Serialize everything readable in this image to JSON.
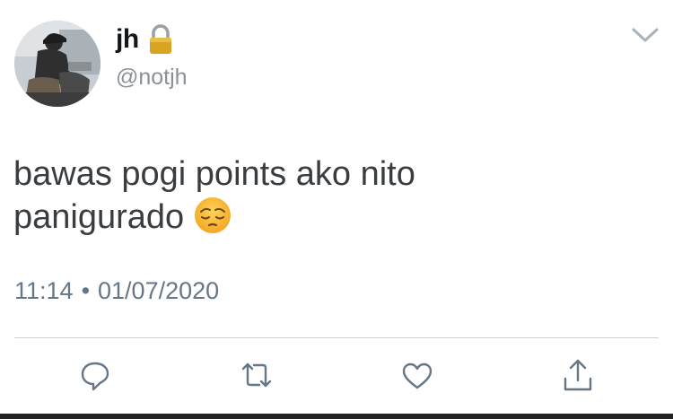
{
  "user": {
    "display_name": "jh",
    "handle": "@notjh",
    "protected_icon": "lock-icon",
    "avatar": "profile-photo"
  },
  "menu_icon": "chevron-down-icon",
  "tweet": {
    "text_line1": "bawas pogi points ako nito",
    "text_line2": "panigurado",
    "emoji": "pensive-face-emoji",
    "time": "11:14",
    "separator": "•",
    "date": "01/07/2020"
  },
  "actions": [
    {
      "name": "reply",
      "icon": "reply-icon"
    },
    {
      "name": "retweet",
      "icon": "retweet-icon"
    },
    {
      "name": "like",
      "icon": "heart-icon"
    },
    {
      "name": "share",
      "icon": "share-icon"
    }
  ],
  "colors": {
    "text": "#14171a",
    "secondary": "#657786",
    "icon": "#657786",
    "divider": "#c9d1d8"
  }
}
